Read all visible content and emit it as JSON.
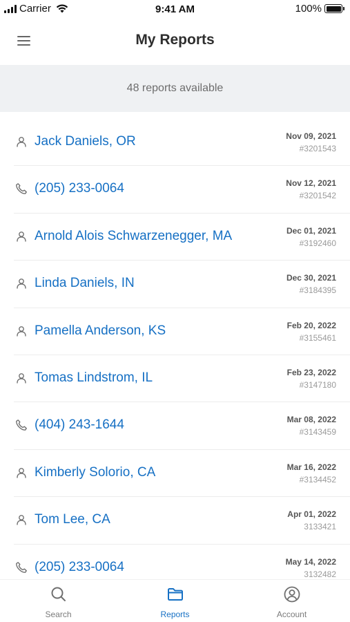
{
  "status_bar": {
    "carrier": "Carrier",
    "time": "9:41 AM",
    "battery": "100%"
  },
  "header": {
    "title": "My Reports"
  },
  "summary": {
    "text": "48 reports available"
  },
  "colors": {
    "accent": "#1670c4",
    "subheader_bg": "#eff1f3"
  },
  "reports": [
    {
      "type": "person",
      "icon": "person-icon",
      "name": "Jack Daniels, OR",
      "date": "Nov 09, 2021",
      "id": "#3201543"
    },
    {
      "type": "phone",
      "icon": "phone-icon",
      "name": "(205) 233-0064",
      "date": "Nov 12, 2021",
      "id": "#3201542"
    },
    {
      "type": "person",
      "icon": "person-icon",
      "name": "Arnold Alois Schwarzenegger, MA",
      "date": "Dec 01, 2021",
      "id": "#3192460"
    },
    {
      "type": "person",
      "icon": "person-icon",
      "name": "Linda Daniels, IN",
      "date": "Dec 30, 2021",
      "id": "#3184395"
    },
    {
      "type": "person",
      "icon": "person-icon",
      "name": "Pamella Anderson, KS",
      "date": "Feb 20, 2022",
      "id": "#3155461"
    },
    {
      "type": "person",
      "icon": "person-icon",
      "name": "Tomas Lindstrom, IL",
      "date": "Feb 23, 2022",
      "id": "#3147180"
    },
    {
      "type": "phone",
      "icon": "phone-icon",
      "name": "(404) 243-1644",
      "date": "Mar 08, 2022",
      "id": "#3143459"
    },
    {
      "type": "person",
      "icon": "person-icon",
      "name": "Kimberly Solorio, CA",
      "date": "Mar 16, 2022",
      "id": "#3134452"
    },
    {
      "type": "person",
      "icon": "person-icon",
      "name": "Tom Lee, CA",
      "date": "Apr 01, 2022",
      "id": "3133421"
    },
    {
      "type": "phone",
      "icon": "phone-icon",
      "name": "(205) 233-0064",
      "date": "May 14, 2022",
      "id": "3132482"
    }
  ],
  "tabs": [
    {
      "label": "Search",
      "icon": "search-icon",
      "active": false
    },
    {
      "label": "Reports",
      "icon": "folder-icon",
      "active": true
    },
    {
      "label": "Account",
      "icon": "account-icon",
      "active": false
    }
  ]
}
